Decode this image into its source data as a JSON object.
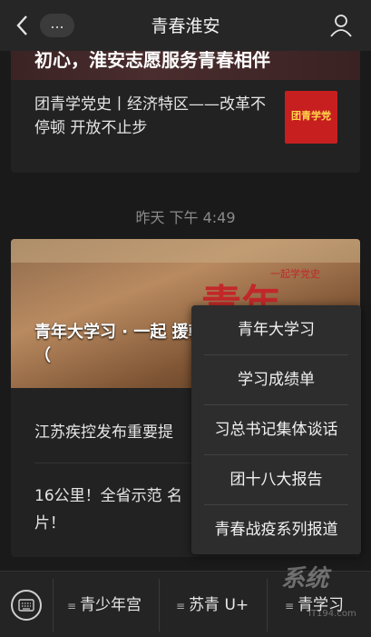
{
  "header": {
    "title": "青春淮安",
    "more_label": "..."
  },
  "card1": {
    "hero_text": "初心，淮安志愿服务青春相伴",
    "article_title": "团青学党史丨经济特区——改革不停顿 开放不止步",
    "thumb_text": "团青学党"
  },
  "timestamp": "昨天 下午 4:49",
  "card2": {
    "hero_caption": "青年大学习 · 一起 援朝 保家卫国 （",
    "hero_big": "青年",
    "hero_tag": "一起学党史",
    "item1": "江苏疾控发布重要提",
    "item2": "16公里！全省示范 名片！"
  },
  "menu": {
    "items": [
      "青年大学习",
      "学习成绩单",
      "习总书记集体谈话",
      "团十八大报告",
      "青春战疫系列报道"
    ]
  },
  "tabbar": {
    "items": [
      "青少年宫",
      "苏青 U+",
      "青学习"
    ]
  },
  "watermark": {
    "text": "系统",
    "site": "IT194.com"
  }
}
